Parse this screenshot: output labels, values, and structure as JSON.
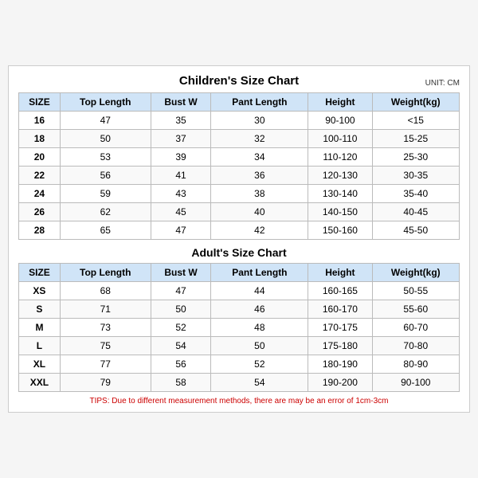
{
  "unit": "UNIT: CM",
  "children": {
    "title": "Children's Size Chart",
    "headers": [
      "SIZE",
      "Top Length",
      "Bust W",
      "Pant Length",
      "Height",
      "Weight(kg)"
    ],
    "rows": [
      [
        "16",
        "47",
        "35",
        "30",
        "90-100",
        "<15"
      ],
      [
        "18",
        "50",
        "37",
        "32",
        "100-110",
        "15-25"
      ],
      [
        "20",
        "53",
        "39",
        "34",
        "110-120",
        "25-30"
      ],
      [
        "22",
        "56",
        "41",
        "36",
        "120-130",
        "30-35"
      ],
      [
        "24",
        "59",
        "43",
        "38",
        "130-140",
        "35-40"
      ],
      [
        "26",
        "62",
        "45",
        "40",
        "140-150",
        "40-45"
      ],
      [
        "28",
        "65",
        "47",
        "42",
        "150-160",
        "45-50"
      ]
    ]
  },
  "adults": {
    "title": "Adult's Size Chart",
    "headers": [
      "SIZE",
      "Top Length",
      "Bust W",
      "Pant Length",
      "Height",
      "Weight(kg)"
    ],
    "rows": [
      [
        "XS",
        "68",
        "47",
        "44",
        "160-165",
        "50-55"
      ],
      [
        "S",
        "71",
        "50",
        "46",
        "160-170",
        "55-60"
      ],
      [
        "M",
        "73",
        "52",
        "48",
        "170-175",
        "60-70"
      ],
      [
        "L",
        "75",
        "54",
        "50",
        "175-180",
        "70-80"
      ],
      [
        "XL",
        "77",
        "56",
        "52",
        "180-190",
        "80-90"
      ],
      [
        "XXL",
        "79",
        "58",
        "54",
        "190-200",
        "90-100"
      ]
    ]
  },
  "tips": "TIPS: Due to different measurement methods, there are may be an error of 1cm-3cm"
}
